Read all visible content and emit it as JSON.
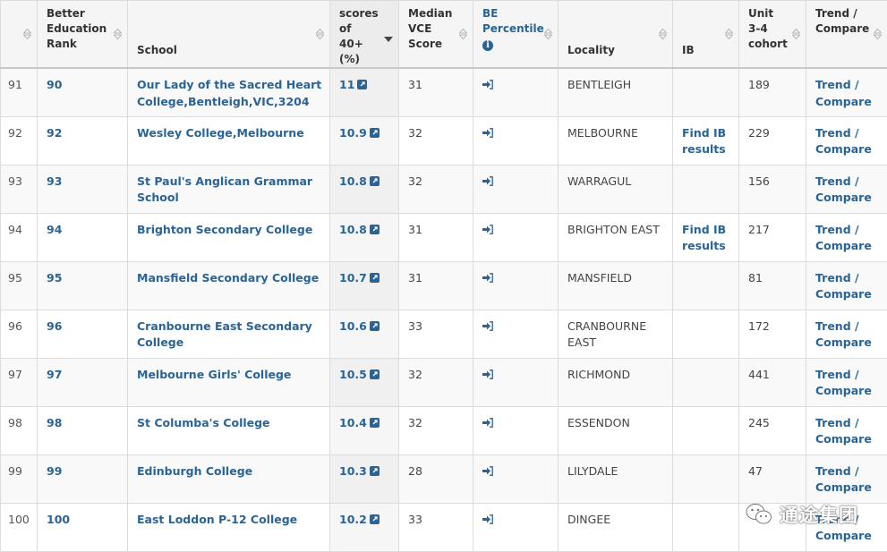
{
  "columns": {
    "row_num": "",
    "be_rank": "Better Education Rank",
    "school": "School",
    "scores40": "scores of 40+ (%)",
    "median": "Median VCE Score",
    "be_percentile": "BE Percentile",
    "locality": "Locality",
    "ib": "IB",
    "cohort": "Unit 3-4 cohort",
    "trend": "Trend / Compare"
  },
  "icons": {
    "sort": "sort-up-down-icon",
    "sort_desc": "sort-descending-icon",
    "info": "info-icon",
    "external": "external-link-icon",
    "percentile": "sign-in-arrow-icon"
  },
  "colors": {
    "link": "#2a6496",
    "header_bg": "#f5f5f5",
    "odd_row": "#f9f9f9"
  },
  "rows": [
    {
      "num": "91",
      "rank": "90",
      "school": "Our Lady of the Sacred Heart College,Bentleigh,VIC,3204",
      "score": "11",
      "median": "31",
      "locality": "BENTLEIGH",
      "ib": "",
      "cohort": "189",
      "trend": "Trend / Compare"
    },
    {
      "num": "92",
      "rank": "92",
      "school": "Wesley College,Melbourne",
      "score": "10.9",
      "median": "32",
      "locality": "MELBOURNE",
      "ib": "Find IB results",
      "cohort": "229",
      "trend": "Trend / Compare"
    },
    {
      "num": "93",
      "rank": "93",
      "school": "St Paul's Anglican Grammar School",
      "score": "10.8",
      "median": "32",
      "locality": "WARRAGUL",
      "ib": "",
      "cohort": "156",
      "trend": "Trend / Compare"
    },
    {
      "num": "94",
      "rank": "94",
      "school": "Brighton Secondary College",
      "score": "10.8",
      "median": "31",
      "locality": "BRIGHTON EAST",
      "ib": "Find IB results",
      "cohort": "217",
      "trend": "Trend / Compare"
    },
    {
      "num": "95",
      "rank": "95",
      "school": "Mansfield Secondary College",
      "score": "10.7",
      "median": "31",
      "locality": "MANSFIELD",
      "ib": "",
      "cohort": "81",
      "trend": "Trend / Compare"
    },
    {
      "num": "96",
      "rank": "96",
      "school": "Cranbourne East Secondary College",
      "score": "10.6",
      "median": "33",
      "locality": "CRANBOURNE EAST",
      "ib": "",
      "cohort": "172",
      "trend": "Trend / Compare"
    },
    {
      "num": "97",
      "rank": "97",
      "school": "Melbourne Girls' College",
      "score": "10.5",
      "median": "32",
      "locality": "RICHMOND",
      "ib": "",
      "cohort": "441",
      "trend": "Trend / Compare"
    },
    {
      "num": "98",
      "rank": "98",
      "school": "St Columba's College",
      "score": "10.4",
      "median": "32",
      "locality": "ESSENDON",
      "ib": "",
      "cohort": "245",
      "trend": "Trend / Compare"
    },
    {
      "num": "99",
      "rank": "99",
      "school": "Edinburgh College",
      "score": "10.3",
      "median": "28",
      "locality": "LILYDALE",
      "ib": "",
      "cohort": "47",
      "trend": "Trend / Compare"
    },
    {
      "num": "100",
      "rank": "100",
      "school": "East Loddon P-12 College",
      "score": "10.2",
      "median": "33",
      "locality": "DINGEE",
      "ib": "",
      "cohort": "",
      "trend": "Trend / Compare"
    }
  ],
  "watermark": {
    "text": "通途集团",
    "icon": "wechat-icon"
  }
}
